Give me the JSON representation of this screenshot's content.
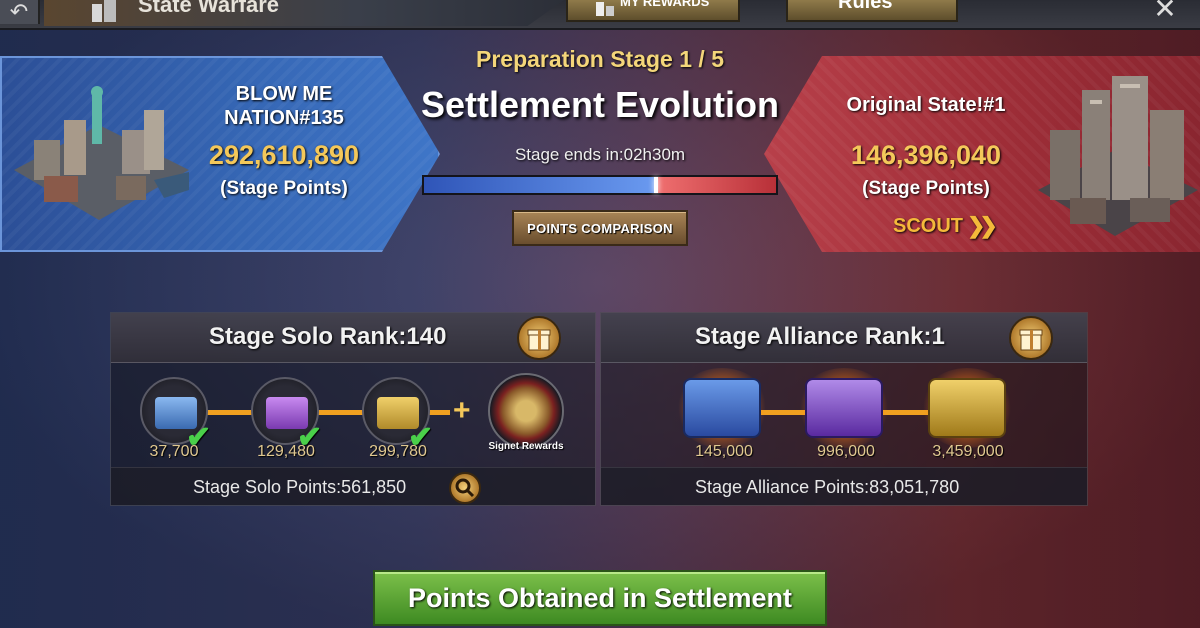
{
  "header": {
    "title": "State Warfare",
    "my_rewards_label": "MY REWARDS",
    "rules_label": "Rules"
  },
  "stage": {
    "label": "Preparation Stage 1 / 5",
    "title": "Settlement Evolution",
    "ends_in": "Stage ends in:02h30m",
    "progress_blue_fraction": 0.66,
    "points_comparison_label": "POINTS COMPARISON"
  },
  "blue_team": {
    "name_line1": "BLOW ME",
    "name_line2": "NATION#135",
    "points": "292,610,890",
    "points_label": "(Stage Points)"
  },
  "red_team": {
    "name": "Original State!#1",
    "points": "146,396,040",
    "points_label": "(Stage Points)",
    "scout_label": "SCOUT"
  },
  "solo_rank": {
    "title": "Stage Solo Rank:140",
    "milestones": [
      "37,700",
      "129,480",
      "299,780"
    ],
    "signet_label": "Signet Rewards",
    "points_text": "Stage Solo Points:561,850"
  },
  "alliance_rank": {
    "title": "Stage Alliance Rank:1",
    "milestones": [
      "145,000",
      "996,000",
      "3,459,000"
    ],
    "points_text": "Stage Alliance Points:83,051,780"
  },
  "settlement_button_label": "Points Obtained in Settlement",
  "colors": {
    "gold_text": "#f4c85a",
    "stage_label": "#f4d67a",
    "blue_team": "#3566b4",
    "red_team": "#a02e38",
    "progress_connector": "#f0a020",
    "settlement_button": "#5aa636"
  },
  "icons": {
    "back": "back-arrow-icon",
    "title": "state-warfare-icon",
    "my_rewards": "rewards-icon",
    "close": "close-icon",
    "scout": "double-chevron-right-icon",
    "gift": "gift-icon",
    "search": "magnifier-icon",
    "claimed": "checkmark-icon"
  }
}
